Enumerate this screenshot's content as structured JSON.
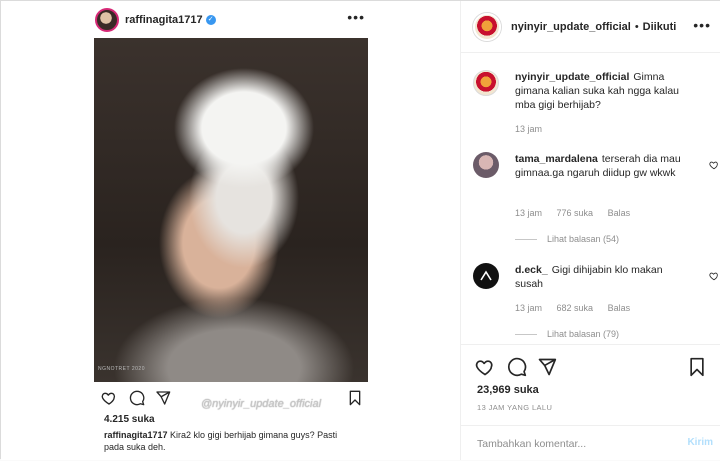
{
  "left_post": {
    "username": "raffinagita1717",
    "verified_mark": "✓",
    "more": "•••",
    "photo_credit": "NGNOTRET 2020",
    "likes": "4.215 suka",
    "watermark": "@nyinyir_update_official",
    "caption_user": "raffinagita1717",
    "caption_text": "Kira2 klo gigi berhijab gimana guys? Pasti pada suka deh."
  },
  "header": {
    "username": "nyinyir_update_official",
    "separator": "•",
    "follow_status": "Diikuti",
    "more": "•••"
  },
  "caption": {
    "username": "nyinyir_update_official",
    "text": "Gimna gimana kalian suka kah ngga kalau mba gigi berhijab?",
    "time": "13 jam"
  },
  "comments": [
    {
      "username": "tama_mardalena",
      "text": "terserah dia mau gimnaa.ga ngaruh diidup gw wkwk",
      "time": "13 jam",
      "likes": "776 suka",
      "reply": "Balas",
      "view_replies": "Lihat balasan (54)"
    },
    {
      "username": "d.eck_",
      "text": "Gigi dihijabin klo makan susah",
      "time": "13 jam",
      "likes": "682 suka",
      "reply": "Balas",
      "view_replies": "Lihat balasan (79)"
    }
  ],
  "footer": {
    "likes": "23,969 suka",
    "time": "13 JAM YANG LALU",
    "input_placeholder": "Tambahkan komentar...",
    "send_label": "Kirim"
  },
  "icons": {
    "like": "heart-icon",
    "comment": "comment-icon",
    "share": "share-icon",
    "save": "bookmark-icon"
  },
  "colors": {
    "text": "#262626",
    "muted": "#8e8e8e",
    "link_disabled": "#b2dffc",
    "verified": "#3897f0",
    "border": "#dbdbdb"
  }
}
